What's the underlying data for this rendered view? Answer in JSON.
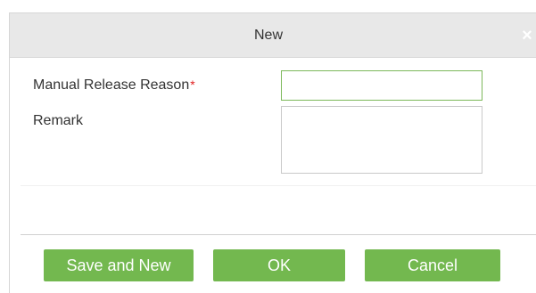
{
  "dialog": {
    "title": "New",
    "close_icon": "×"
  },
  "form": {
    "reason_label": "Manual Release Reason",
    "required_mark": "*",
    "reason_value": "",
    "remark_label": "Remark",
    "remark_value": ""
  },
  "buttons": {
    "save_and_new": "Save and New",
    "ok": "OK",
    "cancel": "Cancel"
  },
  "colors": {
    "button_green": "#73b84f",
    "header_gray": "#e8e8e8",
    "required_red": "#e02020",
    "focus_border": "#7cb85a"
  }
}
